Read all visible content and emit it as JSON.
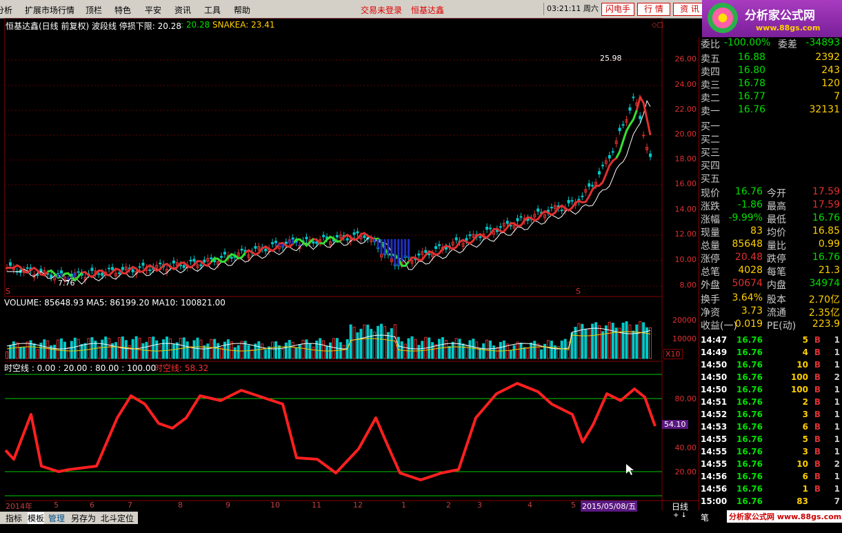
{
  "menu": {
    "items": [
      "分析",
      "扩展市场行情",
      "顶栏",
      "特色",
      "平安",
      "资讯",
      "工具",
      "帮助"
    ],
    "login1": "交易未登录",
    "login2": "恒基达鑫",
    "clock": "03:21:11 周六",
    "btn_flash": "闪电手",
    "btn_quote": "行 情",
    "btn_info": "资 讯"
  },
  "logo": {
    "title": "分析家公式网",
    "url": "www.88gs.com"
  },
  "chart": {
    "title": "恒基达鑫(日线 前复权) 波段线  停损下限: 20.28",
    "val2": ": 20.28",
    "snake": "SNAKEA: 23.41",
    "high_label": "25.98",
    "low_label": "7.76",
    "price_ticks": [
      "26.00",
      "24.00",
      "22.00",
      "20.00",
      "18.00",
      "16.00",
      "14.00",
      "12.00",
      "10.00",
      "8.00"
    ],
    "s_marker": "S",
    "vol_title": "VOLUME: 85648.93  MA5: 86199.20  MA10: 100821.00",
    "vol_ticks": [
      "20000",
      "10000"
    ],
    "vol_unit": "X10",
    "osc_title": "时空线 : 0.00 : 20.00 : 80.00 : 100.00",
    "osc_val": "时空线: 58.32",
    "osc_ticks": [
      "80.00",
      "40.00",
      "20.00"
    ],
    "osc_current": "54.10",
    "dates": [
      "2014年",
      "5",
      "6",
      "7",
      "8",
      "9",
      "10",
      "11",
      "12",
      "1",
      "2",
      "3",
      "4",
      "5",
      "2015/05/08/五"
    ],
    "period": "日线"
  },
  "side": {
    "header": {
      "wb": "委比",
      "wb_val": "-100.00%",
      "wc": "委差",
      "wc_val": "-34893"
    },
    "sell": [
      [
        "卖五",
        "16.88",
        "2392"
      ],
      [
        "卖四",
        "16.80",
        "243"
      ],
      [
        "卖三",
        "16.78",
        "120"
      ],
      [
        "卖二",
        "16.77",
        "7"
      ],
      [
        "卖一",
        "16.76",
        "32131"
      ]
    ],
    "buy": [
      "买一",
      "买二",
      "买三",
      "买四",
      "买五"
    ],
    "stats": [
      [
        "现价",
        "16.76",
        "今开",
        "17.59"
      ],
      [
        "涨跌",
        "-1.86",
        "最高",
        "17.59"
      ],
      [
        "涨幅",
        "-9.99%",
        "最低",
        "16.76"
      ],
      [
        "现量",
        "83",
        "均价",
        "16.85"
      ],
      [
        "总量",
        "85648",
        "量比",
        "0.99"
      ],
      [
        "涨停",
        "20.48",
        "跌停",
        "16.76"
      ],
      [
        "总笔",
        "4028",
        "每笔",
        "21.3"
      ],
      [
        "外盘",
        "50674",
        "内盘",
        "34974"
      ]
    ],
    "fund": [
      [
        "换手",
        "3.64%",
        "股本",
        "2.70亿"
      ],
      [
        "净资",
        "3.73",
        "流通",
        "2.35亿"
      ],
      [
        "收益(一)",
        "0.019",
        "PE(动)",
        "223.9"
      ]
    ],
    "ticks": [
      [
        "14:47",
        "16.76",
        "5",
        "B",
        "1"
      ],
      [
        "14:49",
        "16.76",
        "4",
        "B",
        "1"
      ],
      [
        "14:50",
        "16.76",
        "10",
        "B",
        "1"
      ],
      [
        "14:50",
        "16.76",
        "100",
        "B",
        "2"
      ],
      [
        "14:50",
        "16.76",
        "100",
        "B",
        "1"
      ],
      [
        "14:51",
        "16.76",
        "2",
        "B",
        "1"
      ],
      [
        "14:52",
        "16.76",
        "3",
        "B",
        "1"
      ],
      [
        "14:53",
        "16.76",
        "6",
        "B",
        "1"
      ],
      [
        "14:55",
        "16.76",
        "5",
        "B",
        "1"
      ],
      [
        "14:55",
        "16.76",
        "3",
        "B",
        "1"
      ],
      [
        "14:55",
        "16.76",
        "10",
        "B",
        "2"
      ],
      [
        "14:56",
        "16.76",
        "6",
        "B",
        "1"
      ],
      [
        "14:56",
        "16.76",
        "1",
        "B",
        "1"
      ],
      [
        "15:00",
        "16.76",
        "83",
        "",
        "7"
      ]
    ]
  },
  "bottom": {
    "tabs": [
      "指标",
      "模板",
      "管理",
      "另存为",
      "北斗定位"
    ],
    "ad": "分析家公式网 www.88gs.com",
    "side_tab": "笔"
  }
}
